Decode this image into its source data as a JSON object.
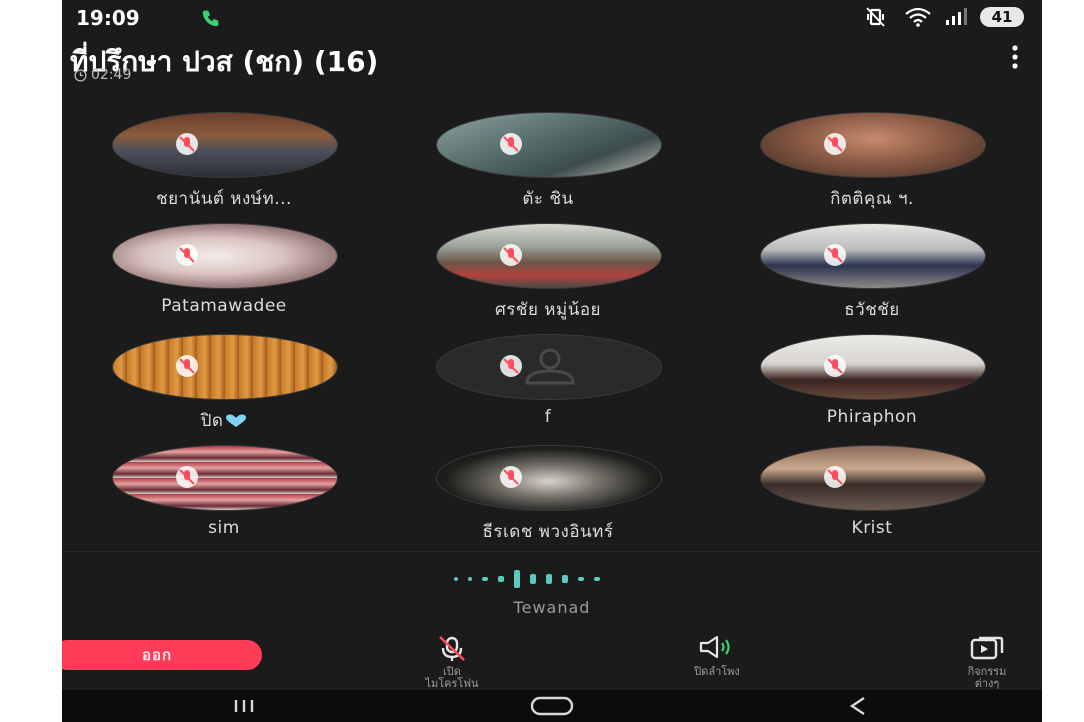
{
  "status_bar": {
    "time": "19:09",
    "battery": "41",
    "icons": [
      "call-active-icon",
      "mute-vibrate-icon",
      "wifi-icon",
      "signal-icon",
      "battery-icon"
    ]
  },
  "header": {
    "title": "ที่ปรึกษา ปวส (ชก) (16)",
    "timer": "02:49",
    "icons": [
      "clock-icon",
      "more-vert-icon"
    ]
  },
  "participants": [
    {
      "name": "ชยานันต์ หงษ์ท...",
      "avatar": "photo"
    },
    {
      "name": "ตัะ ชิน",
      "avatar": "photo"
    },
    {
      "name": "กิตติคุณ ฯ.",
      "avatar": "photo"
    },
    {
      "name": "Patamawadee",
      "avatar": "photo"
    },
    {
      "name": "ศรชัย หมู่น้อย",
      "avatar": "photo"
    },
    {
      "name": "ธวัชชัย",
      "avatar": "photo"
    },
    {
      "name": "ปิด",
      "avatar": "photo",
      "emoji": "blue-heart-icon"
    },
    {
      "name": "f",
      "avatar": "default-person-icon"
    },
    {
      "name": "Phiraphon",
      "avatar": "photo"
    },
    {
      "name": "sim",
      "avatar": "photo"
    },
    {
      "name": "ธีรเดช พวงอินทร์",
      "avatar": "photo"
    },
    {
      "name": "Krist",
      "avatar": "photo"
    }
  ],
  "active_speaker": {
    "name": "Tewanad"
  },
  "controls": {
    "leave": "ออก",
    "mic_label_1": "เปิด",
    "mic_label_2": "ไมโครโฟน",
    "speaker_label": "ปิดลำโพง",
    "activities_label_1": "กิจกรรม",
    "activities_label_2": "ต่างๆ"
  },
  "colors": {
    "background": "#1b1b1b",
    "leave_button": "#ff3b58",
    "accent_teal": "#5cc9c0",
    "speaker_on": "#3bd16f",
    "mute_red": "#ff4d5e"
  }
}
